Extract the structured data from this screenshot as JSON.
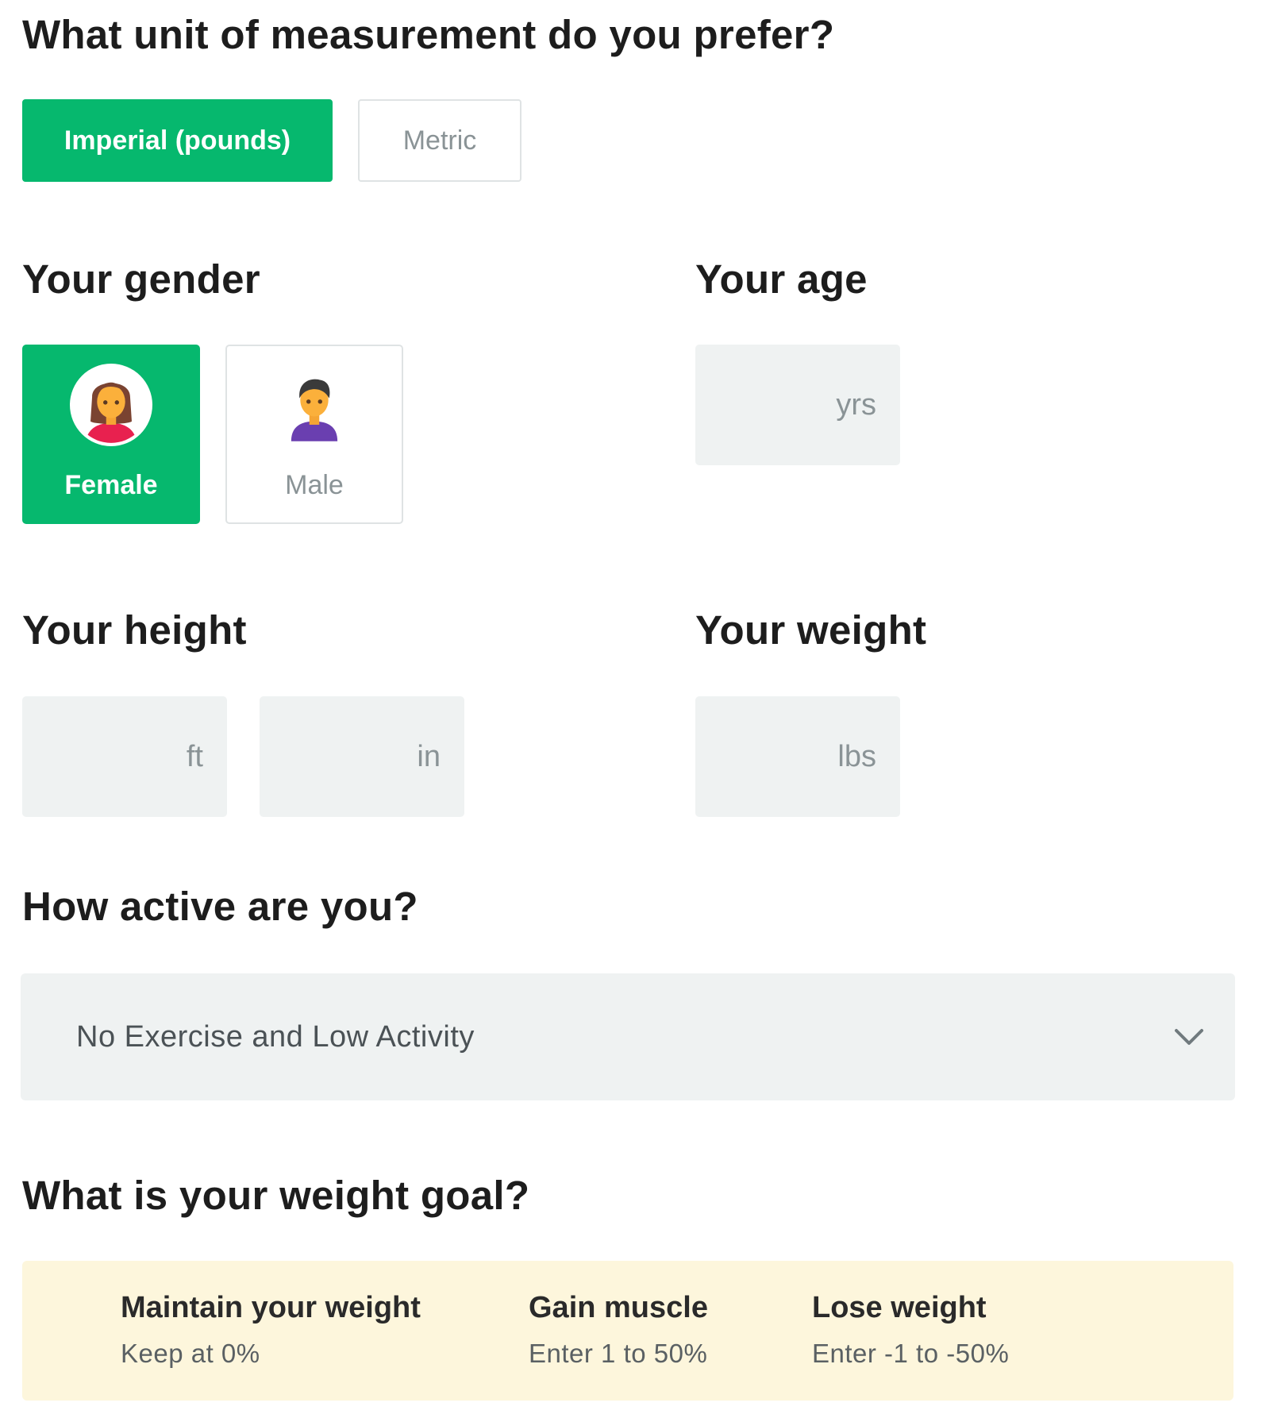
{
  "units": {
    "heading": "What unit of measurement do you prefer?",
    "options": [
      {
        "label": "Imperial (pounds)",
        "selected": true
      },
      {
        "label": "Metric",
        "selected": false
      }
    ]
  },
  "gender": {
    "heading": "Your gender",
    "options": [
      {
        "label": "Female",
        "icon": "female-avatar-icon",
        "selected": true
      },
      {
        "label": "Male",
        "icon": "male-avatar-icon",
        "selected": false
      }
    ]
  },
  "age": {
    "heading": "Your age",
    "unit": "yrs",
    "value": ""
  },
  "height": {
    "heading": "Your height",
    "feet_unit": "ft",
    "inches_unit": "in",
    "feet_value": "",
    "inches_value": ""
  },
  "weight": {
    "heading": "Your weight",
    "unit": "lbs",
    "value": ""
  },
  "activity": {
    "heading": "How active are you?",
    "selected": "No Exercise and Low Activity",
    "icon": "chevron-down-icon"
  },
  "goal": {
    "heading": "What is your weight goal?",
    "options": [
      {
        "title": "Maintain your weight",
        "subtitle": "Keep at 0%"
      },
      {
        "title": "Gain muscle",
        "subtitle": "Enter 1 to 50%"
      },
      {
        "title": "Lose weight",
        "subtitle": "Enter -1 to -50%"
      }
    ]
  },
  "colors": {
    "accent": "#06b86e",
    "input_bg": "#eff2f2",
    "goal_bg": "#fdf6dc",
    "muted_text": "#8a9396"
  }
}
